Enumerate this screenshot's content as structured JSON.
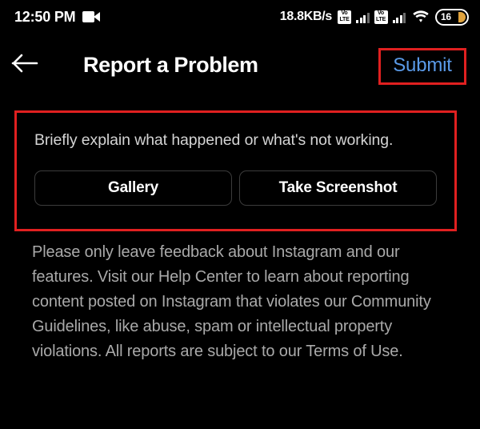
{
  "status_bar": {
    "time": "12:50 PM",
    "recording_icon": "video-camera-icon",
    "network_speed": "18.8KB/s",
    "sim1_label": "VoLTE",
    "sim1_top": "Vo",
    "sim1_bottom": "LTE",
    "sim2_top": "Vo",
    "sim2_bottom": "LTE",
    "wifi_icon": "wifi-icon",
    "battery_percent": "16"
  },
  "header": {
    "back_icon": "arrow-left-icon",
    "title": "Report a Problem",
    "submit_label": "Submit"
  },
  "report_form": {
    "placeholder": "Briefly explain what happened or what's not working.",
    "gallery_label": "Gallery",
    "screenshot_label": "Take Screenshot"
  },
  "disclaimer": {
    "text": "Please only leave feedback about Instagram and our features. Visit our Help Center to learn about reporting content posted on Instagram that violates our Community Guidelines, like abuse, spam or intellectual property violations. All reports are subject to our Terms of Use."
  },
  "colors": {
    "background": "#000000",
    "accent_link": "#5a9ae8",
    "annotation": "#e02020",
    "secondary_text": "#a9a9a9",
    "battery_fill": "#e0a33e"
  }
}
